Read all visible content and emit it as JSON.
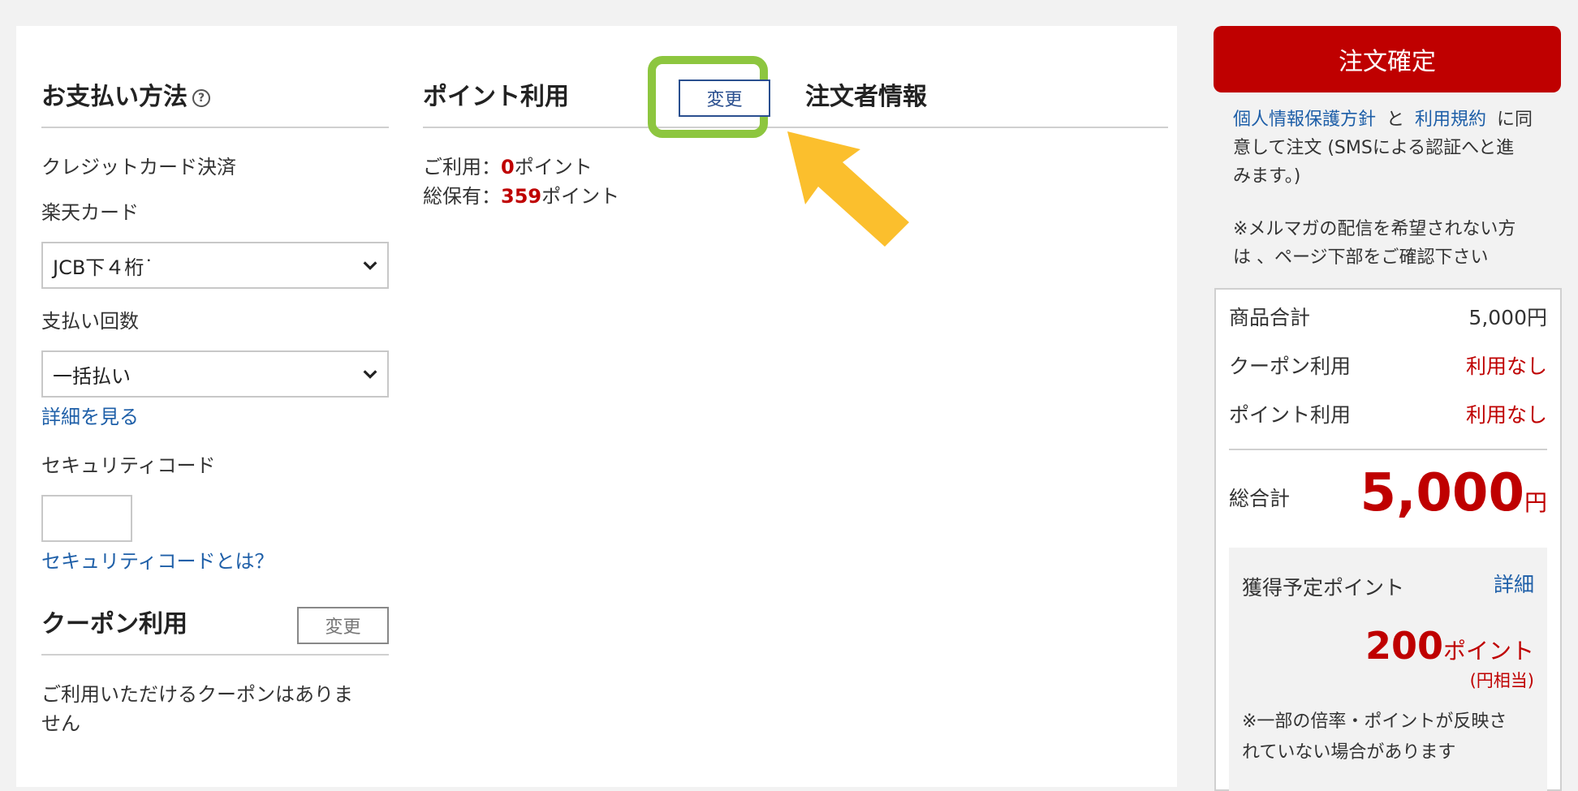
{
  "payment": {
    "title": "お支払い方法",
    "help_icon": "question-circle-icon",
    "method": "クレジットカード決済",
    "card_label": "楽天カード",
    "card_select": "JCB下４桁˙",
    "installments_label": "支払い回数",
    "installments_select": "一括払い",
    "details_link": "詳細を見る",
    "security_code_label": "セキュリティコード",
    "security_code_value": "",
    "security_code_link": "セキュリティコードとは？"
  },
  "coupon": {
    "title": "クーポン利用",
    "change_label": "変更",
    "message_line1": "ご利用いただけるクーポンはありま",
    "message_line2": "せん"
  },
  "points": {
    "title": "ポイント利用",
    "change_label": "変更",
    "use_label": "ご利用：",
    "use_value": "0",
    "use_unit": "ポイント",
    "holding_label": "総保有：",
    "holding_value": "359",
    "holding_unit": "ポイント"
  },
  "orderer": {
    "title": "注文者情報"
  },
  "sidebar": {
    "confirm_button": "注文確定",
    "privacy_link": "個人情報保護方針",
    "and": "と",
    "terms_link": "利用規約",
    "agree_text1": "に同",
    "agree_text2": "意して注文 (SMSによる認証へと進",
    "agree_text3": "みます。)",
    "mail_note1": "※メルマガの配信を希望されない方",
    "mail_note2": "は 、ページ下部をご確認下さい",
    "subtotal_label": "商品合計",
    "subtotal_value": "5,000円",
    "coupon_label": "クーポン利用",
    "coupon_value": "利用なし",
    "point_label": "ポイント利用",
    "point_value": "利用なし",
    "total_label": "総合計",
    "total_value": "5,000",
    "total_unit": "円",
    "earn_label": "獲得予定ポイント",
    "earn_detail_link": "詳細",
    "earn_value": "200",
    "earn_unit": "ポイント",
    "earn_note": "(円相当)",
    "earn_footnote1": "※一部の倍率・ポイントが反映さ",
    "earn_footnote2": "れていない場合があります"
  },
  "colors": {
    "accent_red": "#bf0000",
    "link_blue": "#1e5fa8",
    "highlight_green": "#8dc63f",
    "arrow_yellow": "#fbbf2d"
  },
  "annotation": {
    "arrow_icon": "pointer-arrow-icon"
  }
}
